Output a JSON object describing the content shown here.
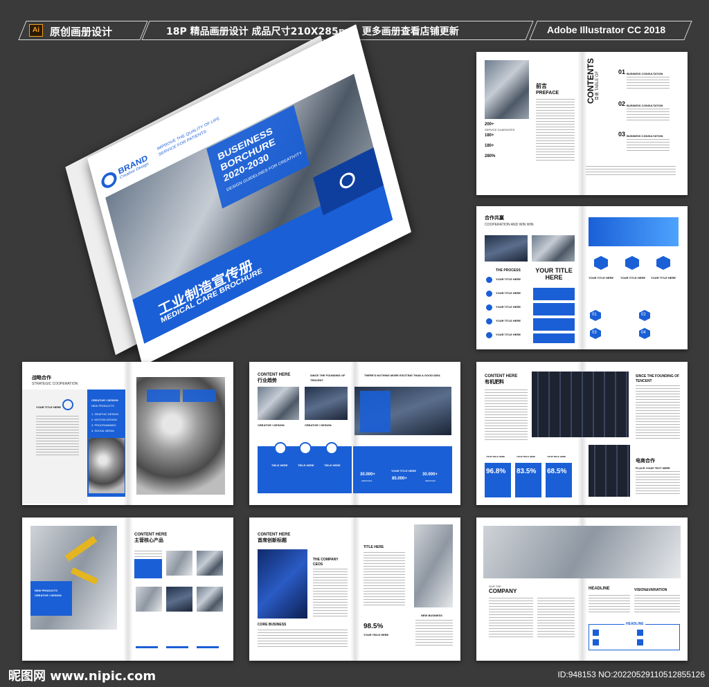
{
  "banner": {
    "ai_badge": "Ai",
    "tab1": "原创画册设计",
    "tab2": "18P 精品画册设计  成品尺寸210X285mm  更多画册查看店铺更新",
    "tab3": "Adobe Illustrator CC 2018"
  },
  "cover": {
    "brand": "BRAND",
    "brand_sub": "Creative Design",
    "tagline1": "IMPROVE THE QUALITY OF LIFE",
    "tagline2": "SERVICE FOR PATIENTS",
    "title1": "BUSEINESS",
    "title2": "BORCHURE",
    "title3": "2020-2030",
    "subtitle": "DESIGN GUIDELINES FOR CREATIVITY",
    "cn_title": "工业制造宣传册",
    "en_title": "MEDICAL CARE BROCHURE"
  },
  "spread1": {
    "preface_cn": "前言",
    "preface_en": "PREFACE",
    "stat1": "200+",
    "stat2": "180+",
    "stat3": "180+",
    "stat4": "280%",
    "stat_label": "SERVICE GUARANTEE",
    "contents_title": "CONTENTS",
    "contents_sub": "目录 TABLE OF",
    "item1_num": "01",
    "item2_num": "02",
    "item3_num": "03",
    "item_title": "BUSINESS CONSULTATION"
  },
  "spread2": {
    "header_cn": "合作共赢",
    "header_en": "COOPERATION AND WIN WIN",
    "process": "THE PROCESS",
    "your_title": "YOUR TITLE HERE",
    "big_title": "YOUR TITLE HERE",
    "num1": "01",
    "num2": "02",
    "num3": "03",
    "num4": "04"
  },
  "spread3": {
    "header_cn": "战略合作",
    "header_en": "STRATEGIC COOPERATION",
    "your_title": "YOUR TITLE HERE",
    "box_title": "CREATIVE / DESIGN",
    "box_sub": "NEW PRODUCTS",
    "list1": "1. GRAPHIC DESIGN",
    "list2": "2. MOTION DESIGN",
    "list3": "3. PROGRAMMING",
    "list4": "4. SOCIAL MEDIA"
  },
  "spread4": {
    "content_here": "CONTENT HERE",
    "cn": "行业趋势",
    "since": "SINCE THE FOUNDING OF TENCENT",
    "nothing": "THERE'S NOTHING MORE EXCITING THAN A GOOD IDEA",
    "creative": "CREATIVE / DESIGN",
    "title_here": "TIELE HERE",
    "your_title": "YOUR TITLE HERE",
    "stat1": "30.000+",
    "stat2": "85.000+",
    "stat3": "30.000+",
    "services": "SERVICES"
  },
  "spread5": {
    "content_here": "CONTENT HERE",
    "cn": "有机肥料",
    "since": "SINCE THE FOUNDING OF TENCENT",
    "pct1": "96.8%",
    "pct2": "83.5%",
    "pct3": "68.5%",
    "your_title": "YOUR TIELE HERE",
    "ecommerce": "电商合作",
    "place": "PLACE YOUR TEXT HERE"
  },
  "spread6": {
    "content_here": "CONTENT HERE",
    "cn": "主营核心产品",
    "new_products": "NEW PRODUCTS",
    "creative": "CREATIVE / DESIGN"
  },
  "spread7": {
    "content_here": "CONTENT HERE",
    "cn": "首席创新标题",
    "company": "THE COMPANY CEOS",
    "core": "CORE BUSINESS",
    "title_here": "TITLE HERE",
    "pct": "98.5%",
    "your_title": "YOUR TIELE HERE",
    "new_business": "NEW BUSINESS"
  },
  "spread8": {
    "our": "OUR THE",
    "company": "COMPANY",
    "headline": "HEADLINE",
    "vision": "VISION&VARIATION",
    "headline_box": "HEADLINE"
  },
  "footer": {
    "left": "昵图网 www.nipic.com",
    "right": "ID:948153 NO:20220529110512855126"
  }
}
